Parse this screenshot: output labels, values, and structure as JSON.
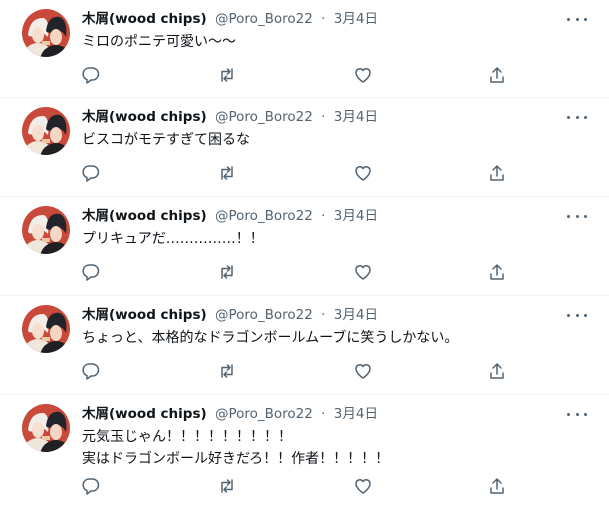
{
  "tweets": [
    {
      "author": "木屑(wood chips)",
      "handle": "@Poro_Boro22",
      "sep": "·",
      "date": "3月4日",
      "lines": [
        "ミロのポニテ可愛い～～"
      ]
    },
    {
      "author": "木屑(wood chips)",
      "handle": "@Poro_Boro22",
      "sep": "·",
      "date": "3月4日",
      "lines": [
        "ビスコがモテすぎて困るな"
      ]
    },
    {
      "author": "木屑(wood chips)",
      "handle": "@Poro_Boro22",
      "sep": "·",
      "date": "3月4日",
      "lines": [
        "プリキュアだ……………！！"
      ]
    },
    {
      "author": "木屑(wood chips)",
      "handle": "@Poro_Boro22",
      "sep": "·",
      "date": "3月4日",
      "lines": [
        "ちょっと、本格的なドラゴンボールムーブに笑うしかない。"
      ]
    },
    {
      "author": "木屑(wood chips)",
      "handle": "@Poro_Boro22",
      "sep": "·",
      "date": "3月4日",
      "lines": [
        "元気玉じゃん！！！！！！！！！",
        "実はドラゴンボール好きだろ！！作者！！！！！"
      ]
    }
  ],
  "icons": {
    "more": "more-horizontal-icon",
    "reply": "reply-icon",
    "retweet": "retweet-icon",
    "like": "heart-icon",
    "share": "share-icon",
    "avatar": "user-avatar-illustration"
  },
  "colors": {
    "text": "#0f1419",
    "secondary": "#536471",
    "divider": "#eff3f4",
    "avatar_bg": "#c94a3a"
  }
}
